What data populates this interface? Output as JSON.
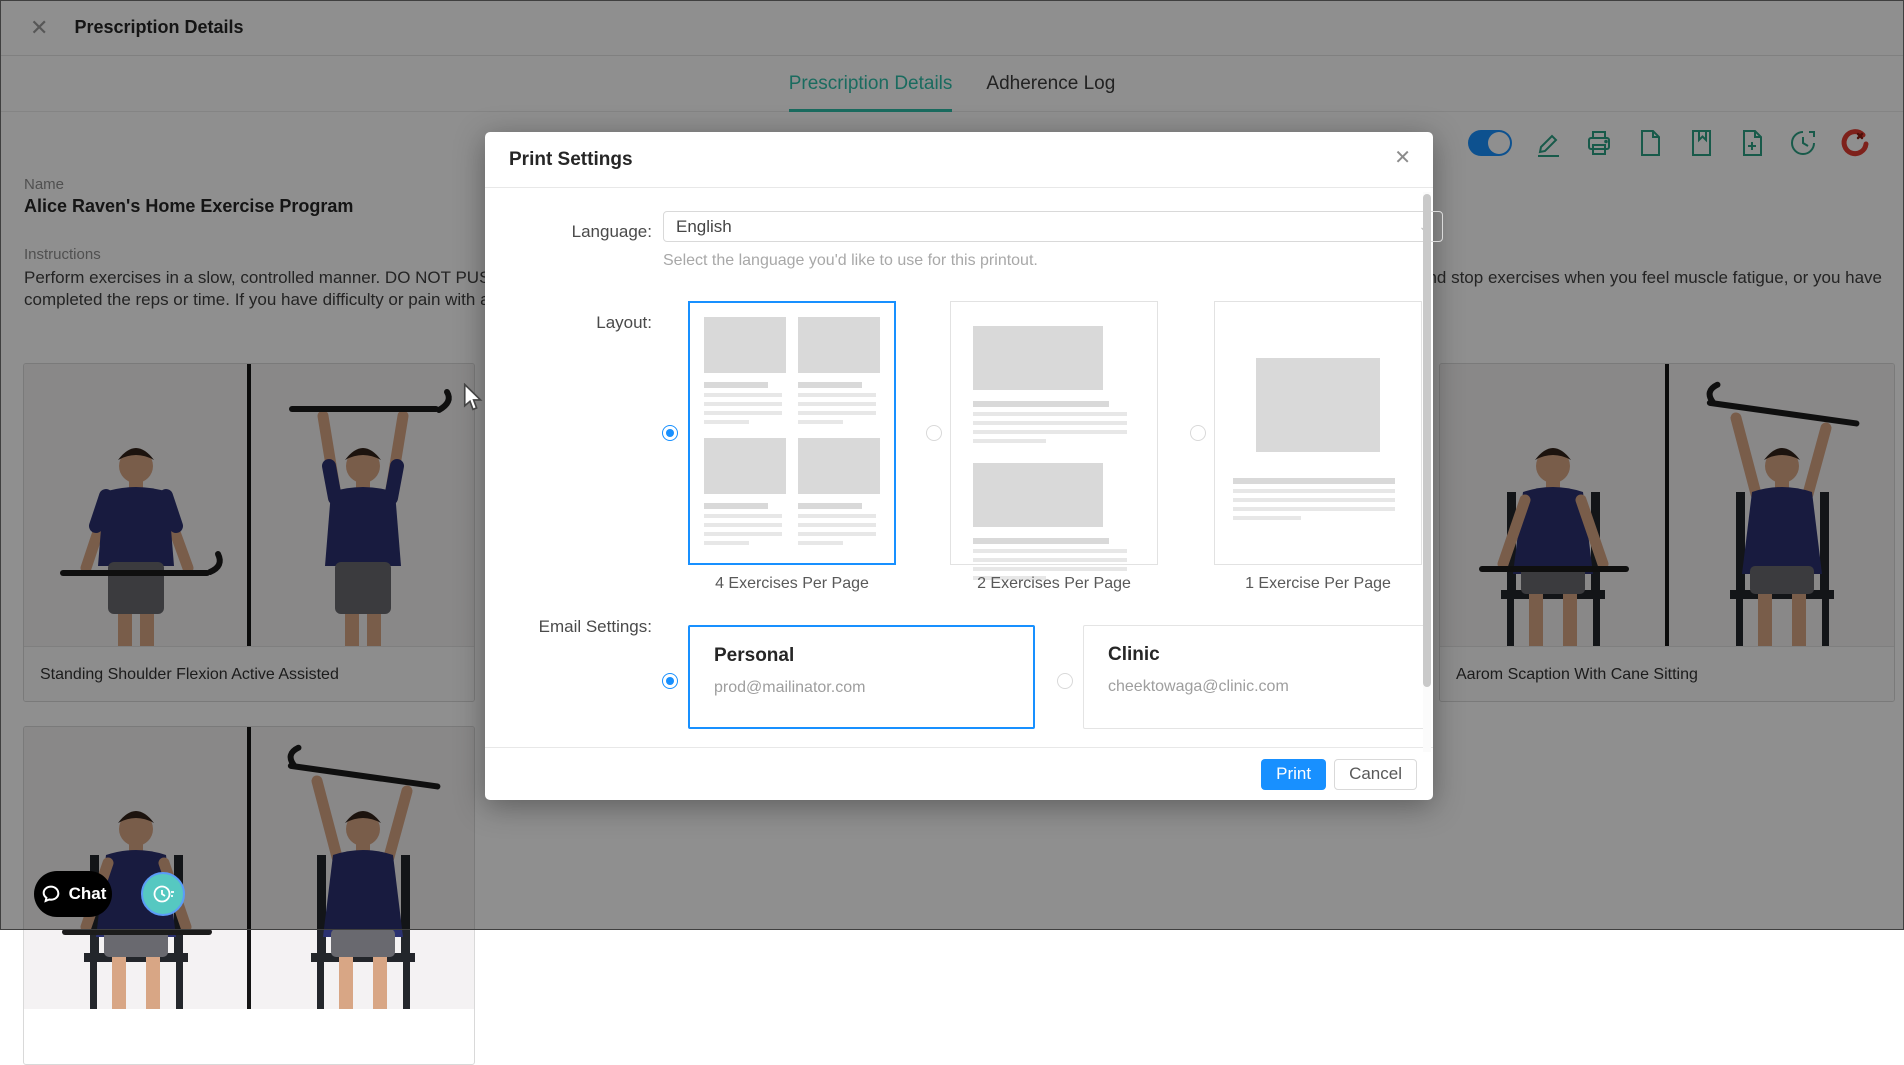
{
  "window": {
    "title": "Prescription Details",
    "close_icon": "x-close-icon"
  },
  "tabs": [
    {
      "label": "Prescription Details",
      "active": true
    },
    {
      "label": "Adherence Log",
      "active": false
    }
  ],
  "toolbar": {
    "icons": [
      "toggle-on",
      "edit-pencil",
      "printer",
      "document",
      "document-bookmark",
      "document-add",
      "history-clock",
      "reset-red"
    ],
    "toggle_state": "on",
    "accent_green": "#2ba084",
    "accent_red": "#e03c31",
    "toggle_blue": "#1890ff"
  },
  "program": {
    "name_label": "Name",
    "name": "Alice Raven's Home Exercise Program",
    "instructions_label": "Instructions",
    "instructions_line1_left": "Perform exercises in a slow, controlled manner. DO NOT PUSH THROUGH P",
    "instructions_line1_right": "rm and stop exercises when you feel muscle fatigue, or you have",
    "instructions_line2": "completed the reps or time. If you have difficulty or pain with an exercise, s"
  },
  "exercises": [
    {
      "title": "Standing Shoulder Flexion Active Assisted"
    },
    {
      "title": "Aarom Scaption With Cane Sitting"
    }
  ],
  "modal": {
    "title": "Print Settings",
    "language_label": "Language:",
    "language_value": "English",
    "language_help": "Select the language you'd like to use for this printout.",
    "layout_label": "Layout:",
    "layout_options": [
      {
        "label": "4 Exercises Per Page",
        "selected": true
      },
      {
        "label": "2 Exercises Per Page",
        "selected": false
      },
      {
        "label": "1 Exercise Per Page",
        "selected": false
      }
    ],
    "email_label": "Email Settings:",
    "email_options": [
      {
        "title": "Personal",
        "email": "prod@mailinator.com",
        "selected": true
      },
      {
        "title": "Clinic",
        "email": "cheektowaga@clinic.com",
        "selected": false
      }
    ],
    "print_button": "Print",
    "cancel_button": "Cancel",
    "accent_blue": "#1890ff"
  },
  "chat": {
    "label": "Chat"
  }
}
